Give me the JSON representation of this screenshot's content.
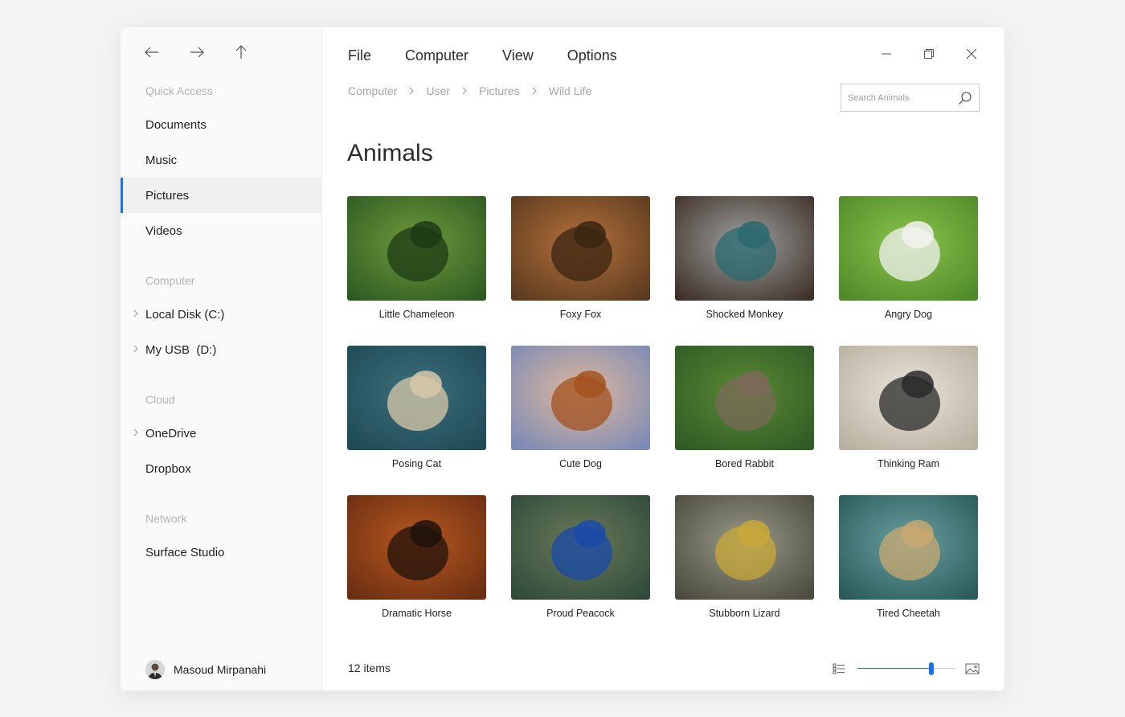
{
  "menu": [
    "File",
    "Computer",
    "View",
    "Options"
  ],
  "breadcrumb": [
    "Computer",
    "User",
    "Pictures",
    "Wild Life"
  ],
  "search": {
    "placeholder": "Search Animals"
  },
  "sidebar": {
    "quick_access_label": "Quick Access",
    "quick_access": [
      "Documents",
      "Music",
      "Pictures",
      "Videos"
    ],
    "active_item": "Pictures",
    "computer_label": "Computer",
    "computer": [
      "Local Disk (C:)",
      "My USB  (D:)"
    ],
    "cloud_label": "Cloud",
    "cloud": [
      "OneDrive",
      "Dropbox"
    ],
    "network_label": "Network",
    "network": [
      "Surface Studio"
    ]
  },
  "user": {
    "name": "Masoud Mirpanahi"
  },
  "page_title": "Animals",
  "items": [
    {
      "caption": "Little Chameleon",
      "colors": [
        "#2e5a22",
        "#6f9b3c",
        "#1c3a14"
      ]
    },
    {
      "caption": "Foxy Fox",
      "colors": [
        "#5a3a1f",
        "#b5713a",
        "#3a2412"
      ]
    },
    {
      "caption": "Shocked Monkey",
      "colors": [
        "#3e3029",
        "#9ea2a0",
        "#2a6a70"
      ]
    },
    {
      "caption": "Angry Dog",
      "colors": [
        "#4e8a2a",
        "#8bc34a",
        "#f2f2f0"
      ]
    },
    {
      "caption": "Posing Cat",
      "colors": [
        "#1f4a55",
        "#3c6f7c",
        "#d8c8a8"
      ]
    },
    {
      "caption": "Cute Dog",
      "colors": [
        "#7a8ab8",
        "#e0b89a",
        "#a2521f"
      ]
    },
    {
      "caption": "Bored Rabbit",
      "colors": [
        "#2f5a24",
        "#5a8a35",
        "#7a6a58"
      ]
    },
    {
      "caption": "Thinking Ram",
      "colors": [
        "#b8b0a0",
        "#eae4da",
        "#2a2a2a"
      ]
    },
    {
      "caption": "Dramatic Horse",
      "colors": [
        "#6a2e12",
        "#b8581f",
        "#1e120a"
      ]
    },
    {
      "caption": "Proud Peacock",
      "colors": [
        "#2f4a3a",
        "#6a7a5a",
        "#1a4aa8"
      ]
    },
    {
      "caption": "Stubborn Lizard",
      "colors": [
        "#4a4a3e",
        "#9a9a88",
        "#c8a838"
      ]
    },
    {
      "caption": "Tired Cheetah",
      "colors": [
        "#2a5a5a",
        "#6aa0a0",
        "#c8a870"
      ]
    }
  ],
  "status": {
    "count": "12 items"
  },
  "zoom": {
    "level_fraction": 0.75
  },
  "accent_color": "#1a73e8"
}
